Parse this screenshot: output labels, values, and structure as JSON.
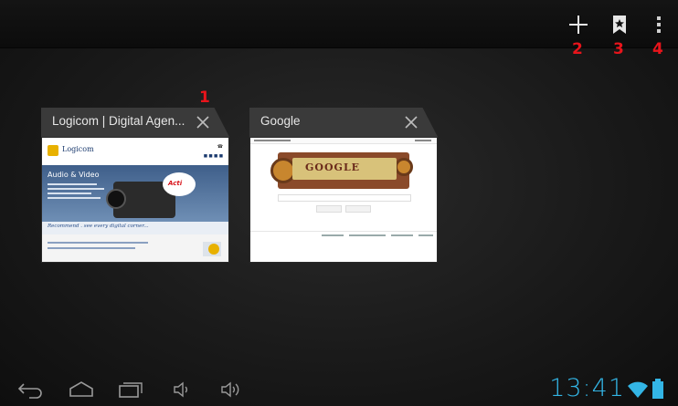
{
  "action_bar": {
    "new_tab_icon": "plus-icon",
    "bookmarks_icon": "bookmark-star-icon",
    "menu_icon": "overflow-menu-icon"
  },
  "callouts": [
    "1",
    "2",
    "3",
    "4"
  ],
  "tabs": [
    {
      "title": "Logicom | Digital Agen...",
      "close_icon": "close-icon",
      "page": {
        "logo_text": "Logicom",
        "hero_title": "Audio & Video",
        "badge_text": "Acti",
        "strip_text": "Recommend . see every digital corner..."
      }
    },
    {
      "title": "Google",
      "close_icon": "close-icon",
      "page": {
        "doodle_text": "GOOGLE"
      }
    }
  ],
  "system_bar": {
    "back_icon": "back-icon",
    "home_icon": "home-icon",
    "recents_icon": "recent-apps-icon",
    "volume_down_icon": "volume-down-icon",
    "volume_up_icon": "volume-up-icon",
    "time": "13:41",
    "wifi_icon": "wifi-icon",
    "battery_icon": "battery-icon"
  },
  "colors": {
    "callout": "#e8141b",
    "clock": "#33b5e5",
    "tab_header": "#3a3a3a"
  }
}
